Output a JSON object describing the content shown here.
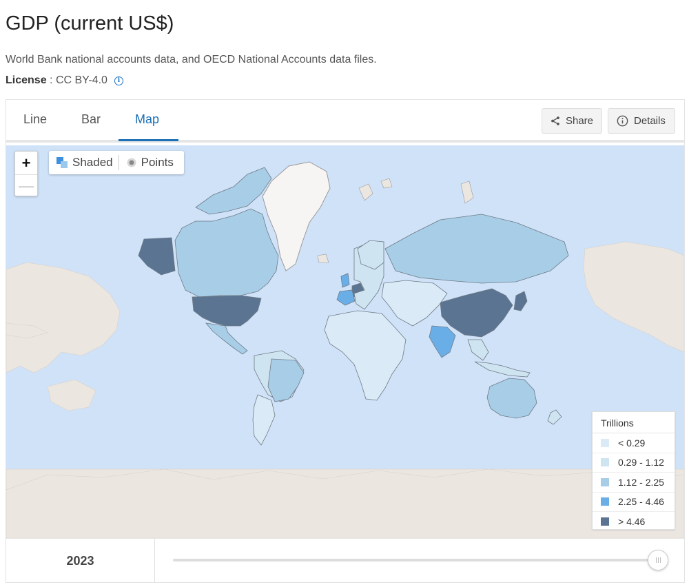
{
  "header": {
    "title": "GDP (current US$)",
    "source": "World Bank national accounts data, and OECD National Accounts data files.",
    "license_label": "License",
    "license_sep": " : ",
    "license_value": "CC BY-4.0"
  },
  "tabs": [
    {
      "label": "Line",
      "active": false
    },
    {
      "label": "Bar",
      "active": false
    },
    {
      "label": "Map",
      "active": true
    }
  ],
  "actions": {
    "share_label": "Share",
    "details_label": "Details"
  },
  "map_controls": {
    "zoom_in": "+",
    "zoom_out": "—",
    "mode_shaded": "Shaded",
    "mode_points": "Points",
    "selected_mode": "Shaded"
  },
  "legend": {
    "title": "Trillions",
    "classes": [
      {
        "label": "< 0.29",
        "color": "#daeaf6"
      },
      {
        "label": "0.29 - 1.12",
        "color": "#cfe4f1"
      },
      {
        "label": "1.12 - 2.25",
        "color": "#a7cde7"
      },
      {
        "label": "2.25 - 4.46",
        "color": "#6aaee7"
      },
      {
        "label": "> 4.46",
        "color": "#5b7492"
      }
    ]
  },
  "map": {
    "ocean_color": "#cfe2f8",
    "land_nodata_color": "#ece6e1",
    "highlighted": [
      {
        "region": "United States",
        "class": "> 4.46"
      },
      {
        "region": "China",
        "class": "> 4.46"
      },
      {
        "region": "Germany",
        "class": "> 4.46"
      },
      {
        "region": "Japan",
        "class": "> 4.46"
      },
      {
        "region": "India",
        "class": "2.25 - 4.46"
      },
      {
        "region": "United Kingdom",
        "class": "2.25 - 4.46"
      },
      {
        "region": "France",
        "class": "2.25 - 4.46"
      },
      {
        "region": "Canada",
        "class": "1.12 - 2.25"
      },
      {
        "region": "Brazil",
        "class": "1.12 - 2.25"
      },
      {
        "region": "Russia",
        "class": "1.12 - 2.25"
      },
      {
        "region": "Australia",
        "class": "1.12 - 2.25"
      }
    ]
  },
  "timeline": {
    "year": "2023",
    "position": 1.0
  }
}
